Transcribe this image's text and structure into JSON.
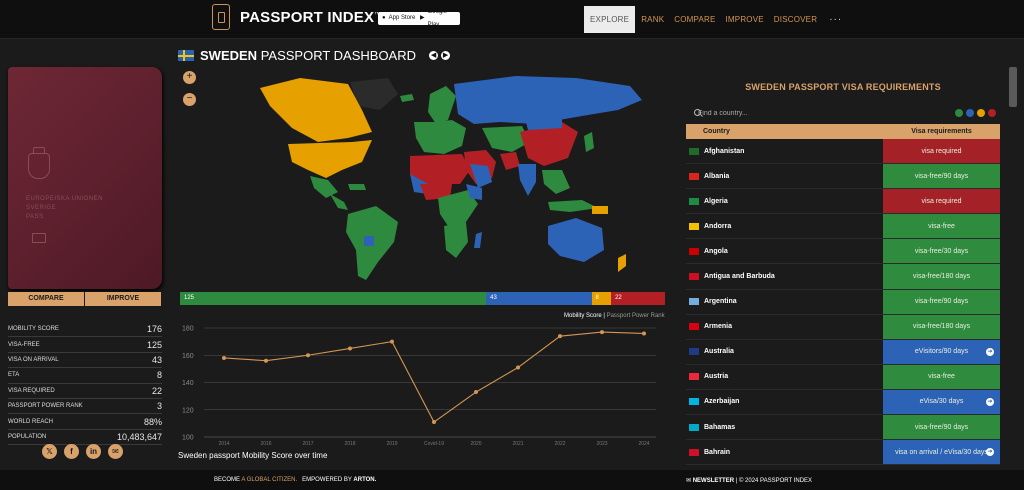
{
  "header": {
    "brand": "PASSPORT INDEX",
    "app_store": "App Store",
    "google_play": "Google Play",
    "nav": [
      "EXPLORE",
      "RANK",
      "COMPARE",
      "IMPROVE",
      "DISCOVER"
    ],
    "more": "···"
  },
  "left": {
    "cover_text": [
      "EUROPEISKA UNIONEN",
      "SVERIGE",
      "PASS"
    ],
    "compare_button": "COMPARE",
    "improve_button": "IMPROVE",
    "stats": [
      {
        "label": "MOBILITY SCORE",
        "value": "176"
      },
      {
        "label": "VISA-FREE",
        "value": "125"
      },
      {
        "label": "VISA ON ARRIVAL",
        "value": "43"
      },
      {
        "label": "ETA",
        "value": "8"
      },
      {
        "label": "VISA REQUIRED",
        "value": "22"
      },
      {
        "label": "PASSPORT POWER RANK",
        "value": "3"
      },
      {
        "label": "WORLD REACH",
        "value": "88%"
      },
      {
        "label": "POPULATION",
        "value": "10,483,647"
      }
    ],
    "social_icons": [
      "x-icon",
      "facebook-icon",
      "linkedin-icon",
      "mail-icon"
    ]
  },
  "dashboard": {
    "title_bold": "SWEDEN",
    "title_rest": "PASSPORT DASHBOARD",
    "zoom_in": "+",
    "zoom_out": "−",
    "split": [
      {
        "label": "125",
        "value": 125,
        "color": "#2e8a3e"
      },
      {
        "label": "43",
        "value": 43,
        "color": "#2d63b6"
      },
      {
        "label": "8",
        "value": 8,
        "color": "#e6a000"
      },
      {
        "label": "22",
        "value": 22,
        "color": "#b22025"
      }
    ],
    "legend_active": "Mobility Score",
    "legend_sep": " | ",
    "legend_inactive": "Passport Power Rank",
    "caption": "Sweden passport Mobility Score over time"
  },
  "chart_data": {
    "type": "line",
    "title": "Sweden passport Mobility Score over time",
    "x": [
      "2014",
      "2016",
      "2017",
      "2018",
      "2019",
      "Covid-19",
      "2020",
      "2021",
      "2022",
      "2023",
      "2024"
    ],
    "series": [
      {
        "name": "Mobility Score",
        "values": [
          158,
          156,
          160,
          165,
          170,
          111,
          133,
          151,
          174,
          177,
          176
        ]
      }
    ],
    "yticks": [
      100,
      120,
      140,
      160,
      180
    ],
    "ylim": [
      100,
      180
    ],
    "grid": true,
    "line_color": "#d49654"
  },
  "visa": {
    "title": "SWEDEN PASSPORT VISA REQUIREMENTS",
    "search_placeholder": "Find a country...",
    "filter_colors": [
      "#2e8a3e",
      "#2d63b6",
      "#e6a000",
      "#b22025"
    ],
    "col_country": "Country",
    "col_req": "Visa requirements",
    "rows": [
      {
        "country": "Afghanistan",
        "req": "visa required",
        "color": "#a32127",
        "flag": "#1f6b2b",
        "info": false
      },
      {
        "country": "Albania",
        "req": "visa-free/90 days",
        "color": "#2f8b3d",
        "flag": "#d9251c",
        "info": false
      },
      {
        "country": "Algeria",
        "req": "visa required",
        "color": "#a32127",
        "flag": "#1f8a43",
        "info": false
      },
      {
        "country": "Andorra",
        "req": "visa-free",
        "color": "#2f8b3d",
        "flag": "#f2c100",
        "info": false
      },
      {
        "country": "Angola",
        "req": "visa-free/30 days",
        "color": "#2f8b3d",
        "flag": "#cc0000",
        "info": false
      },
      {
        "country": "Antigua and Barbuda",
        "req": "visa-free/180 days",
        "color": "#2f8b3d",
        "flag": "#cc1020",
        "info": false
      },
      {
        "country": "Argentina",
        "req": "visa-free/90 days",
        "color": "#2f8b3d",
        "flag": "#74acdf",
        "info": false
      },
      {
        "country": "Armenia",
        "req": "visa-free/180 days",
        "color": "#2f8b3d",
        "flag": "#d90012",
        "info": false
      },
      {
        "country": "Australia",
        "req": "eVisitors/90 days",
        "color": "#2d63b6",
        "flag": "#1f3b86",
        "info": true
      },
      {
        "country": "Austria",
        "req": "visa-free",
        "color": "#2f8b3d",
        "flag": "#ed2939",
        "info": false
      },
      {
        "country": "Azerbaijan",
        "req": "eVisa/30 days",
        "color": "#2d63b6",
        "flag": "#00b5e2",
        "info": true
      },
      {
        "country": "Bahamas",
        "req": "visa-free/90 days",
        "color": "#2f8b3d",
        "flag": "#00abc9",
        "info": false
      },
      {
        "country": "Bahrain",
        "req": "visa on arrival / eVisa/30 days",
        "color": "#2d63b6",
        "flag": "#ce1126",
        "info": true
      }
    ]
  },
  "footer": {
    "become": "BECOME",
    "global": "A GLOBAL CITIZEN.",
    "powered": "EMPOWERED BY",
    "arton": "ARTON.",
    "newsletter": "NEWSLETTER",
    "copyright": " | © 2024 PASSPORT INDEX"
  }
}
